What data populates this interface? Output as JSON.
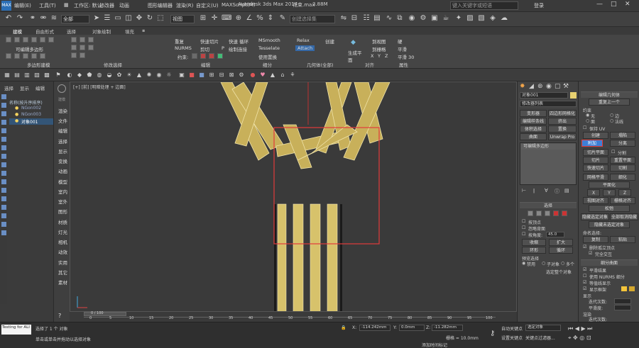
{
  "titlebar": {
    "title": "Autodesk 3ds Max 2014  ",
    "file": "花束.max",
    "mem": "3.88M",
    "workspace_label": "工作区: 默认",
    "search_placeholder": "键入关键字或短语",
    "login": "登录",
    "menus": [
      "编辑(E)",
      "工具(T)",
      "组(G)",
      "视图(V)",
      "创建(C)",
      "修改器",
      "动画",
      "图形编辑器",
      "渲染(R)",
      "自定义(U)",
      "MAXScript(M)",
      "帮助(H)"
    ]
  },
  "quickbar": {
    "select_filter": "全部",
    "snap_percent": "3",
    "named_sel": "创建选择集"
  },
  "ribbon": {
    "tabs": [
      "建模",
      "自由形式",
      "选择",
      "对象绘制",
      "填充"
    ],
    "active_tab": "建模",
    "groups": [
      "多边形建模",
      "修改选择",
      "编辑",
      "几何体(全部)",
      "细分",
      "对齐",
      "属性"
    ],
    "editable_poly": "可编辑多边形",
    "edit_buttons": [
      "重复",
      "快速切片",
      "快速 循环",
      "NURMS",
      "剪切",
      "P",
      "使用置换",
      "约束:",
      "绘制连接",
      "MSmooth",
      "Tesselate",
      "Relax",
      "创建",
      "Attach"
    ],
    "gen_label": "生成平面",
    "align_buttons": [
      "到视图",
      "到栅格",
      "X",
      "Y",
      "Z"
    ],
    "props_buttons": [
      "硬",
      "平滑",
      "平滑 30"
    ]
  },
  "scene_explorer": {
    "tabs": [
      "选择",
      "显示",
      "编辑"
    ],
    "header": "名称(按升序排序)",
    "items": [
      "NGon002",
      "NGon003",
      "对象001"
    ]
  },
  "viewport": {
    "label": "[+] [前] [明暗处理 + 边面]"
  },
  "vertical_tools": {
    "top": "建模",
    "items": [
      "渲染",
      "文件",
      "编辑",
      "选择",
      "显示",
      "变换",
      "动画",
      "模型",
      "室内",
      "室外",
      "图形",
      "材质",
      "灯光",
      "相机",
      "动效",
      "实用",
      "其它",
      "素材"
    ]
  },
  "command_panel": {
    "object_name": "对象001",
    "modifier_list": "修改器列表",
    "buttons": [
      "变形器",
      "四边形网格化",
      "编辑样条线",
      "挤出",
      "体积选择",
      "置换",
      "曲面",
      "Unwrap Pro"
    ],
    "stack_item": "可编辑多边形",
    "selection_title": "选择",
    "by_vertex": "按顶点",
    "ignore_back": "忽略背面",
    "by_angle": "按角度:",
    "angle_val": "45.0",
    "shrink": "收缩",
    "grow": "扩大",
    "ring": "环形",
    "loop": "循环",
    "preview_sel": "预览选择",
    "disabled": "禁用",
    "subobject": "子对象",
    "multi": "多个",
    "selected_count": "选定整个对象"
  },
  "right_panel": {
    "title": "编辑几何体",
    "repeat": "重复上一个",
    "constraint": "约束",
    "none": "无",
    "edge": "边",
    "face": "面",
    "normal": "法线",
    "preserve_uv": "保持 UV",
    "create": "创建",
    "collapse": "塌陷",
    "attach": "附加",
    "detach": "分离",
    "slice_plane": "切片平面",
    "split": "分割",
    "slice": "切片",
    "reset_plane": "重置平面",
    "quickslice": "快速切片",
    "cut": "切割",
    "meshsmooth": "网格平滑",
    "tessellate": "细化",
    "planarize": "平面化",
    "xyz": [
      "X",
      "Y",
      "Z"
    ],
    "view_align": "视图对齐",
    "grid_align": "栅格对齐",
    "relax": "松弛",
    "hide_sel": "隐藏选定对象",
    "unhide_all": "全部取消隐藏",
    "hide_unsel": "隐藏未选定对象",
    "named_sel": "命名选择:",
    "copy": "复制",
    "paste": "粘贴",
    "del_iso": "删除孤立顶点",
    "full_int": "完全交互",
    "subdiv_title": "细分曲面",
    "smooth_result": "平滑结果",
    "use_nurms": "使用 NURMS 细分",
    "iso_disp": "等值线显示",
    "show_cage": "显示框架",
    "display": "显示",
    "iterations": "迭代次数:",
    "smoothness": "平滑度:",
    "render": "渲染",
    "iter_val": "0",
    "smooth_val": "1.0",
    "split_method": "分隔方式"
  },
  "timeline": {
    "frame": "0 / 100",
    "ticks": [
      "0",
      "5",
      "10",
      "15",
      "20",
      "25",
      "30",
      "35",
      "40",
      "45",
      "50",
      "55",
      "60",
      "65",
      "70",
      "75",
      "80",
      "85",
      "90",
      "95",
      "100"
    ]
  },
  "status": {
    "testing": "Testing for ALI",
    "selected": "选择了 1 个 对象",
    "hint": "单击或单击并拖动以选择对象",
    "x_label": "X:",
    "x_val": "-114.242mm",
    "y_label": "Y:",
    "y_val": "0.0mm",
    "z_label": "Z:",
    "z_val": "-11.282mm",
    "grid": "栅格 = 10.0mm",
    "autokey": "自动关键点",
    "sel_obj": "选定对象",
    "setkey": "设置关键点",
    "keyfilter": "关键点过滤器...",
    "add_tag": "添加时间标记"
  }
}
